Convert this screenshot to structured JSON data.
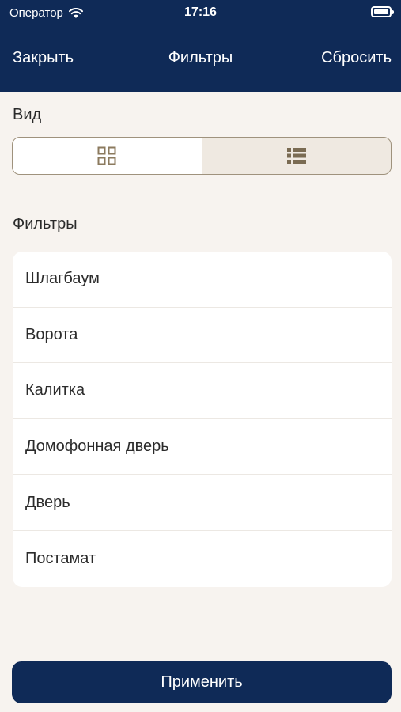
{
  "status_bar": {
    "carrier": "Оператор",
    "time": "17:16",
    "icons": [
      "wifi-icon",
      "battery-icon"
    ]
  },
  "nav": {
    "close_label": "Закрыть",
    "title": "Фильтры",
    "reset_label": "Сбросить"
  },
  "view_section": {
    "label": "Вид",
    "options": [
      {
        "icon": "grid-view-icon",
        "selected": true
      },
      {
        "icon": "list-view-icon",
        "selected": false
      }
    ]
  },
  "filters_section": {
    "label": "Фильтры",
    "items": [
      {
        "label": "Шлагбаум"
      },
      {
        "label": "Ворота"
      },
      {
        "label": "Калитка"
      },
      {
        "label": "Домофонная дверь"
      },
      {
        "label": "Дверь"
      },
      {
        "label": "Постамат"
      }
    ]
  },
  "apply_button": {
    "label": "Применить"
  },
  "colors": {
    "primary": "#0f2a57",
    "background": "#f7f3ef",
    "accent": "#8b7a5e"
  }
}
